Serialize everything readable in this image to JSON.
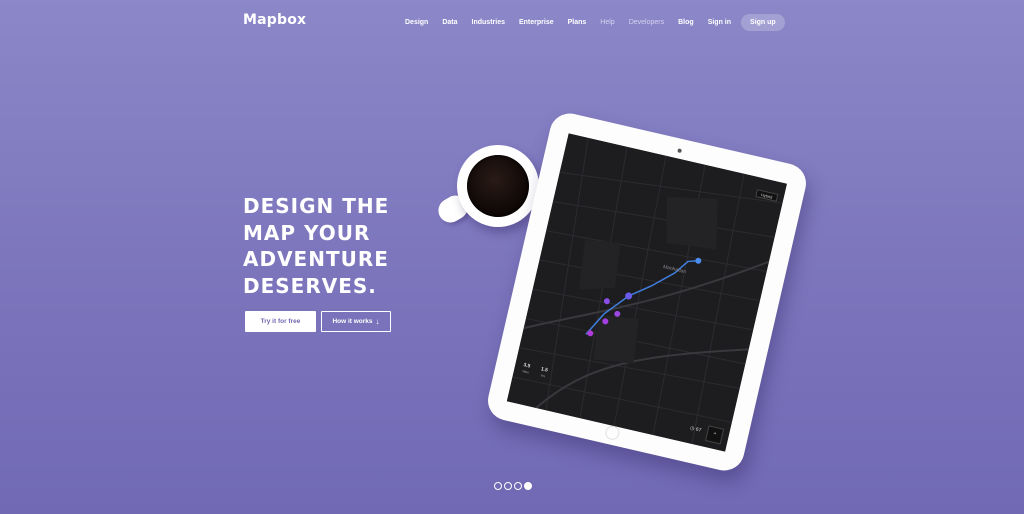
{
  "nav": {
    "logo": "Mapbox",
    "links": [
      "Design",
      "Data",
      "Industries",
      "Enterprise",
      "Plans"
    ],
    "dim_links": [
      "Help",
      "Developers"
    ],
    "blog": "Blog",
    "signin": "Sign in",
    "signup": "Sign up"
  },
  "hero": {
    "headline_lines": [
      "DESIGN THE",
      "MAP YOUR",
      "ADVENTURE",
      "DESERVES."
    ],
    "primary_cta": "Try it for free",
    "secondary_cta": "How it works",
    "secondary_icon": "arrow-down-icon"
  },
  "tablet": {
    "map_place": "Manhattan",
    "dropdown": "Hybrid",
    "stats": [
      {
        "value": "3.5",
        "unit": "miles"
      },
      {
        "value": "1.5",
        "unit": "hrs"
      }
    ],
    "speed": "67"
  },
  "carousel": {
    "count": 4,
    "active_index": 3
  },
  "colors": {
    "bg_top": "#8b87c8",
    "bg_bottom": "#7169b4",
    "primary_text": "#6e67b0",
    "pin_blue": "#4a8df0",
    "pin_purple": "#a43fe0"
  }
}
